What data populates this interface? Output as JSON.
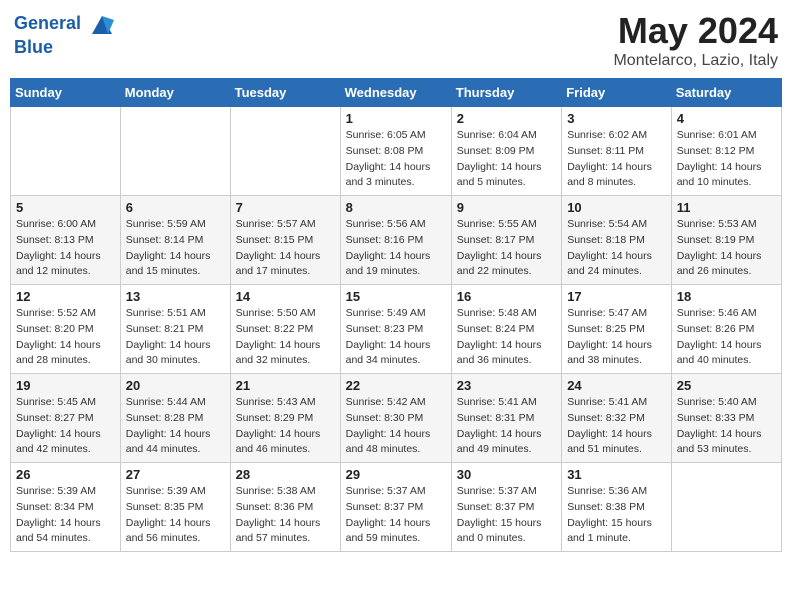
{
  "header": {
    "logo_line1": "General",
    "logo_line2": "Blue",
    "month": "May 2024",
    "location": "Montelarco, Lazio, Italy"
  },
  "days_of_week": [
    "Sunday",
    "Monday",
    "Tuesday",
    "Wednesday",
    "Thursday",
    "Friday",
    "Saturday"
  ],
  "weeks": [
    [
      {
        "day": "",
        "info": ""
      },
      {
        "day": "",
        "info": ""
      },
      {
        "day": "",
        "info": ""
      },
      {
        "day": "1",
        "sunrise": "Sunrise: 6:05 AM",
        "sunset": "Sunset: 8:08 PM",
        "daylight": "Daylight: 14 hours and 3 minutes."
      },
      {
        "day": "2",
        "sunrise": "Sunrise: 6:04 AM",
        "sunset": "Sunset: 8:09 PM",
        "daylight": "Daylight: 14 hours and 5 minutes."
      },
      {
        "day": "3",
        "sunrise": "Sunrise: 6:02 AM",
        "sunset": "Sunset: 8:11 PM",
        "daylight": "Daylight: 14 hours and 8 minutes."
      },
      {
        "day": "4",
        "sunrise": "Sunrise: 6:01 AM",
        "sunset": "Sunset: 8:12 PM",
        "daylight": "Daylight: 14 hours and 10 minutes."
      }
    ],
    [
      {
        "day": "5",
        "sunrise": "Sunrise: 6:00 AM",
        "sunset": "Sunset: 8:13 PM",
        "daylight": "Daylight: 14 hours and 12 minutes."
      },
      {
        "day": "6",
        "sunrise": "Sunrise: 5:59 AM",
        "sunset": "Sunset: 8:14 PM",
        "daylight": "Daylight: 14 hours and 15 minutes."
      },
      {
        "day": "7",
        "sunrise": "Sunrise: 5:57 AM",
        "sunset": "Sunset: 8:15 PM",
        "daylight": "Daylight: 14 hours and 17 minutes."
      },
      {
        "day": "8",
        "sunrise": "Sunrise: 5:56 AM",
        "sunset": "Sunset: 8:16 PM",
        "daylight": "Daylight: 14 hours and 19 minutes."
      },
      {
        "day": "9",
        "sunrise": "Sunrise: 5:55 AM",
        "sunset": "Sunset: 8:17 PM",
        "daylight": "Daylight: 14 hours and 22 minutes."
      },
      {
        "day": "10",
        "sunrise": "Sunrise: 5:54 AM",
        "sunset": "Sunset: 8:18 PM",
        "daylight": "Daylight: 14 hours and 24 minutes."
      },
      {
        "day": "11",
        "sunrise": "Sunrise: 5:53 AM",
        "sunset": "Sunset: 8:19 PM",
        "daylight": "Daylight: 14 hours and 26 minutes."
      }
    ],
    [
      {
        "day": "12",
        "sunrise": "Sunrise: 5:52 AM",
        "sunset": "Sunset: 8:20 PM",
        "daylight": "Daylight: 14 hours and 28 minutes."
      },
      {
        "day": "13",
        "sunrise": "Sunrise: 5:51 AM",
        "sunset": "Sunset: 8:21 PM",
        "daylight": "Daylight: 14 hours and 30 minutes."
      },
      {
        "day": "14",
        "sunrise": "Sunrise: 5:50 AM",
        "sunset": "Sunset: 8:22 PM",
        "daylight": "Daylight: 14 hours and 32 minutes."
      },
      {
        "day": "15",
        "sunrise": "Sunrise: 5:49 AM",
        "sunset": "Sunset: 8:23 PM",
        "daylight": "Daylight: 14 hours and 34 minutes."
      },
      {
        "day": "16",
        "sunrise": "Sunrise: 5:48 AM",
        "sunset": "Sunset: 8:24 PM",
        "daylight": "Daylight: 14 hours and 36 minutes."
      },
      {
        "day": "17",
        "sunrise": "Sunrise: 5:47 AM",
        "sunset": "Sunset: 8:25 PM",
        "daylight": "Daylight: 14 hours and 38 minutes."
      },
      {
        "day": "18",
        "sunrise": "Sunrise: 5:46 AM",
        "sunset": "Sunset: 8:26 PM",
        "daylight": "Daylight: 14 hours and 40 minutes."
      }
    ],
    [
      {
        "day": "19",
        "sunrise": "Sunrise: 5:45 AM",
        "sunset": "Sunset: 8:27 PM",
        "daylight": "Daylight: 14 hours and 42 minutes."
      },
      {
        "day": "20",
        "sunrise": "Sunrise: 5:44 AM",
        "sunset": "Sunset: 8:28 PM",
        "daylight": "Daylight: 14 hours and 44 minutes."
      },
      {
        "day": "21",
        "sunrise": "Sunrise: 5:43 AM",
        "sunset": "Sunset: 8:29 PM",
        "daylight": "Daylight: 14 hours and 46 minutes."
      },
      {
        "day": "22",
        "sunrise": "Sunrise: 5:42 AM",
        "sunset": "Sunset: 8:30 PM",
        "daylight": "Daylight: 14 hours and 48 minutes."
      },
      {
        "day": "23",
        "sunrise": "Sunrise: 5:41 AM",
        "sunset": "Sunset: 8:31 PM",
        "daylight": "Daylight: 14 hours and 49 minutes."
      },
      {
        "day": "24",
        "sunrise": "Sunrise: 5:41 AM",
        "sunset": "Sunset: 8:32 PM",
        "daylight": "Daylight: 14 hours and 51 minutes."
      },
      {
        "day": "25",
        "sunrise": "Sunrise: 5:40 AM",
        "sunset": "Sunset: 8:33 PM",
        "daylight": "Daylight: 14 hours and 53 minutes."
      }
    ],
    [
      {
        "day": "26",
        "sunrise": "Sunrise: 5:39 AM",
        "sunset": "Sunset: 8:34 PM",
        "daylight": "Daylight: 14 hours and 54 minutes."
      },
      {
        "day": "27",
        "sunrise": "Sunrise: 5:39 AM",
        "sunset": "Sunset: 8:35 PM",
        "daylight": "Daylight: 14 hours and 56 minutes."
      },
      {
        "day": "28",
        "sunrise": "Sunrise: 5:38 AM",
        "sunset": "Sunset: 8:36 PM",
        "daylight": "Daylight: 14 hours and 57 minutes."
      },
      {
        "day": "29",
        "sunrise": "Sunrise: 5:37 AM",
        "sunset": "Sunset: 8:37 PM",
        "daylight": "Daylight: 14 hours and 59 minutes."
      },
      {
        "day": "30",
        "sunrise": "Sunrise: 5:37 AM",
        "sunset": "Sunset: 8:37 PM",
        "daylight": "Daylight: 15 hours and 0 minutes."
      },
      {
        "day": "31",
        "sunrise": "Sunrise: 5:36 AM",
        "sunset": "Sunset: 8:38 PM",
        "daylight": "Daylight: 15 hours and 1 minute."
      },
      {
        "day": "",
        "info": ""
      }
    ]
  ]
}
